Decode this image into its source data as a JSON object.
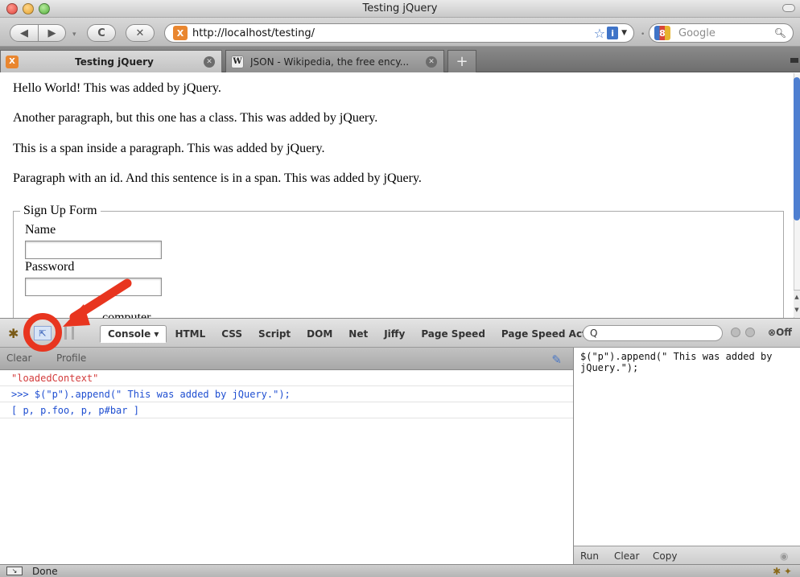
{
  "window": {
    "title": "Testing jQuery"
  },
  "toolbar": {
    "back_glyph": "◀",
    "forward_glyph": "▶",
    "reload_glyph": "C",
    "stop_glyph": "✕",
    "url": "http://localhost/testing/",
    "url_favicon": "X",
    "search_placeholder": "Google",
    "search_engine_icon": "8"
  },
  "tabs": [
    {
      "label": "Testing jQuery",
      "favicon": "X",
      "active": true
    },
    {
      "label": "JSON - Wikipedia, the free ency...",
      "favicon": "W",
      "active": false
    }
  ],
  "page": {
    "paragraphs": [
      "Hello World! This was added by jQuery.",
      "Another paragraph, but this one has a class. This was added by jQuery.",
      "This is a span inside a paragraph. This was added by jQuery.",
      "Paragraph with an id. And this sentence is in a span. This was added by jQuery."
    ],
    "form": {
      "legend": "Sign Up Form",
      "name_label": "Name",
      "password_label": "Password",
      "partial_label": "computer"
    }
  },
  "firebug": {
    "tabs": [
      "Console ▾",
      "HTML",
      "CSS",
      "Script",
      "DOM",
      "Net",
      "Jiffy",
      "Page Speed",
      "Page Speed Activity"
    ],
    "search_placeholder": "Q",
    "off_label": "Off",
    "subbar": {
      "clear": "Clear",
      "profile": "Profile"
    },
    "console_lines": [
      {
        "text": "\"loadedContext\"",
        "color": "#d33c3c"
      },
      {
        "text": ">>> $(\"p\").append(\" This was added by jQuery.\");",
        "color": "#1f4fd1"
      },
      {
        "text": "[ p, p.foo, p, p#bar ]",
        "color": "#1f4fd1"
      }
    ],
    "editor_text": "$(\"p\").append(\" This was added by\njQuery.\");",
    "editor_buttons": {
      "run": "Run",
      "clear": "Clear",
      "copy": "Copy"
    }
  },
  "status": {
    "text": "Done"
  },
  "colors": {
    "accent": "#4e7fd1",
    "annotation": "#e8351f"
  }
}
